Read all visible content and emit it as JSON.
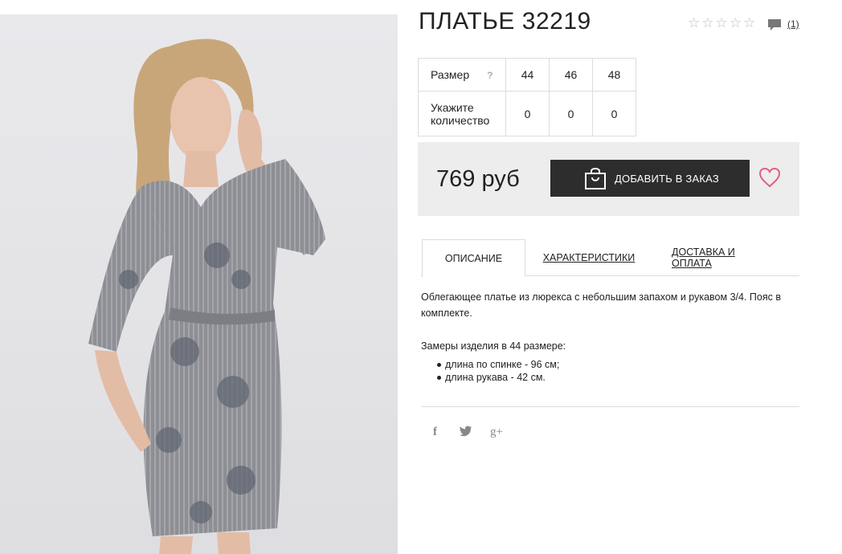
{
  "product": {
    "title": "ПЛАТЬЕ 32219",
    "rating_stars": 5,
    "rating_filled": 0,
    "comments_count": "(1)"
  },
  "sizes": {
    "size_label": "Размер",
    "help": "?",
    "qty_label_line1": "Укажите",
    "qty_label_line2": "количество",
    "values": [
      "44",
      "46",
      "48"
    ],
    "quantities": [
      "0",
      "0",
      "0"
    ]
  },
  "price": {
    "amount": "769 руб",
    "order_button": "ДОБАВИТЬ В ЗАКАЗ"
  },
  "tabs": [
    {
      "label": "ОПИСАНИЕ",
      "active": true
    },
    {
      "label": "ХАРАКТЕРИСТИКИ",
      "active": false
    },
    {
      "label": "ДОСТАВКА И ОПЛАТА",
      "active": false
    }
  ],
  "description": {
    "text": "Облегающее платье из люрекса с небольшим запахом и рукавом 3/4. Пояс в комплекте.",
    "measure_title": "Замеры изделия в 44 размере:",
    "measures": [
      "длина по спинке - 96 см;",
      "длина рукава - 42 см."
    ]
  },
  "social": {
    "facebook": "f",
    "twitter": "t",
    "google": "g+"
  },
  "icons": {
    "bag": "shopping-bag-icon",
    "heart": "heart-icon",
    "comment": "comment-icon",
    "star": "star-icon"
  },
  "colors": {
    "button_bg": "#2d2d2d",
    "price_bg": "#ededed",
    "heart": "#e0607e"
  }
}
